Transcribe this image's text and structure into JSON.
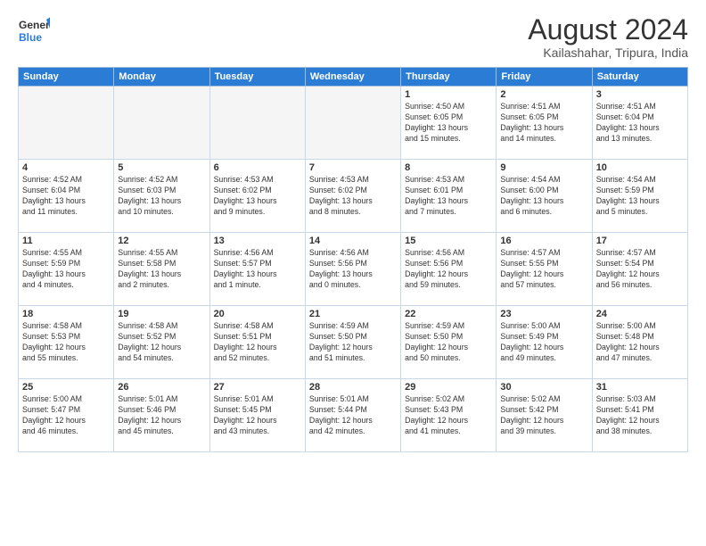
{
  "header": {
    "logo_line1": "General",
    "logo_line2": "Blue",
    "month": "August 2024",
    "location": "Kailashahar, Tripura, India"
  },
  "weekdays": [
    "Sunday",
    "Monday",
    "Tuesday",
    "Wednesday",
    "Thursday",
    "Friday",
    "Saturday"
  ],
  "weeks": [
    [
      {
        "day": "",
        "info": ""
      },
      {
        "day": "",
        "info": ""
      },
      {
        "day": "",
        "info": ""
      },
      {
        "day": "",
        "info": ""
      },
      {
        "day": "1",
        "info": "Sunrise: 4:50 AM\nSunset: 6:05 PM\nDaylight: 13 hours\nand 15 minutes."
      },
      {
        "day": "2",
        "info": "Sunrise: 4:51 AM\nSunset: 6:05 PM\nDaylight: 13 hours\nand 14 minutes."
      },
      {
        "day": "3",
        "info": "Sunrise: 4:51 AM\nSunset: 6:04 PM\nDaylight: 13 hours\nand 13 minutes."
      }
    ],
    [
      {
        "day": "4",
        "info": "Sunrise: 4:52 AM\nSunset: 6:04 PM\nDaylight: 13 hours\nand 11 minutes."
      },
      {
        "day": "5",
        "info": "Sunrise: 4:52 AM\nSunset: 6:03 PM\nDaylight: 13 hours\nand 10 minutes."
      },
      {
        "day": "6",
        "info": "Sunrise: 4:53 AM\nSunset: 6:02 PM\nDaylight: 13 hours\nand 9 minutes."
      },
      {
        "day": "7",
        "info": "Sunrise: 4:53 AM\nSunset: 6:02 PM\nDaylight: 13 hours\nand 8 minutes."
      },
      {
        "day": "8",
        "info": "Sunrise: 4:53 AM\nSunset: 6:01 PM\nDaylight: 13 hours\nand 7 minutes."
      },
      {
        "day": "9",
        "info": "Sunrise: 4:54 AM\nSunset: 6:00 PM\nDaylight: 13 hours\nand 6 minutes."
      },
      {
        "day": "10",
        "info": "Sunrise: 4:54 AM\nSunset: 5:59 PM\nDaylight: 13 hours\nand 5 minutes."
      }
    ],
    [
      {
        "day": "11",
        "info": "Sunrise: 4:55 AM\nSunset: 5:59 PM\nDaylight: 13 hours\nand 4 minutes."
      },
      {
        "day": "12",
        "info": "Sunrise: 4:55 AM\nSunset: 5:58 PM\nDaylight: 13 hours\nand 2 minutes."
      },
      {
        "day": "13",
        "info": "Sunrise: 4:56 AM\nSunset: 5:57 PM\nDaylight: 13 hours\nand 1 minute."
      },
      {
        "day": "14",
        "info": "Sunrise: 4:56 AM\nSunset: 5:56 PM\nDaylight: 13 hours\nand 0 minutes."
      },
      {
        "day": "15",
        "info": "Sunrise: 4:56 AM\nSunset: 5:56 PM\nDaylight: 12 hours\nand 59 minutes."
      },
      {
        "day": "16",
        "info": "Sunrise: 4:57 AM\nSunset: 5:55 PM\nDaylight: 12 hours\nand 57 minutes."
      },
      {
        "day": "17",
        "info": "Sunrise: 4:57 AM\nSunset: 5:54 PM\nDaylight: 12 hours\nand 56 minutes."
      }
    ],
    [
      {
        "day": "18",
        "info": "Sunrise: 4:58 AM\nSunset: 5:53 PM\nDaylight: 12 hours\nand 55 minutes."
      },
      {
        "day": "19",
        "info": "Sunrise: 4:58 AM\nSunset: 5:52 PM\nDaylight: 12 hours\nand 54 minutes."
      },
      {
        "day": "20",
        "info": "Sunrise: 4:58 AM\nSunset: 5:51 PM\nDaylight: 12 hours\nand 52 minutes."
      },
      {
        "day": "21",
        "info": "Sunrise: 4:59 AM\nSunset: 5:50 PM\nDaylight: 12 hours\nand 51 minutes."
      },
      {
        "day": "22",
        "info": "Sunrise: 4:59 AM\nSunset: 5:50 PM\nDaylight: 12 hours\nand 50 minutes."
      },
      {
        "day": "23",
        "info": "Sunrise: 5:00 AM\nSunset: 5:49 PM\nDaylight: 12 hours\nand 49 minutes."
      },
      {
        "day": "24",
        "info": "Sunrise: 5:00 AM\nSunset: 5:48 PM\nDaylight: 12 hours\nand 47 minutes."
      }
    ],
    [
      {
        "day": "25",
        "info": "Sunrise: 5:00 AM\nSunset: 5:47 PM\nDaylight: 12 hours\nand 46 minutes."
      },
      {
        "day": "26",
        "info": "Sunrise: 5:01 AM\nSunset: 5:46 PM\nDaylight: 12 hours\nand 45 minutes."
      },
      {
        "day": "27",
        "info": "Sunrise: 5:01 AM\nSunset: 5:45 PM\nDaylight: 12 hours\nand 43 minutes."
      },
      {
        "day": "28",
        "info": "Sunrise: 5:01 AM\nSunset: 5:44 PM\nDaylight: 12 hours\nand 42 minutes."
      },
      {
        "day": "29",
        "info": "Sunrise: 5:02 AM\nSunset: 5:43 PM\nDaylight: 12 hours\nand 41 minutes."
      },
      {
        "day": "30",
        "info": "Sunrise: 5:02 AM\nSunset: 5:42 PM\nDaylight: 12 hours\nand 39 minutes."
      },
      {
        "day": "31",
        "info": "Sunrise: 5:03 AM\nSunset: 5:41 PM\nDaylight: 12 hours\nand 38 minutes."
      }
    ]
  ]
}
